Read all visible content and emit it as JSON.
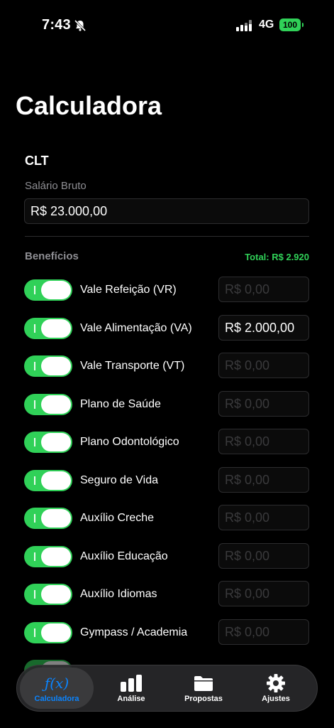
{
  "status": {
    "time": "7:43",
    "network": "4G",
    "battery": "100"
  },
  "title": "Calculadora",
  "salary": {
    "section": "CLT",
    "label": "Salário Bruto",
    "value": "R$ 23.000,00"
  },
  "benefits": {
    "title": "Benefícios",
    "total": "Total: R$ 2.920",
    "items": [
      {
        "label": "Vale Refeição (VR)",
        "value": "R$ 0,00",
        "on": true
      },
      {
        "label": "Vale Alimentação (VA)",
        "value": "R$ 2.000,00",
        "on": true
      },
      {
        "label": "Vale Transporte (VT)",
        "value": "R$ 0,00",
        "on": true
      },
      {
        "label": "Plano de Saúde",
        "value": "R$ 0,00",
        "on": true
      },
      {
        "label": "Plano Odontológico",
        "value": "R$ 0,00",
        "on": true
      },
      {
        "label": "Seguro de Vida",
        "value": "R$ 0,00",
        "on": true
      },
      {
        "label": "Auxílio Creche",
        "value": "R$ 0,00",
        "on": true
      },
      {
        "label": "Auxílio Educação",
        "value": "R$ 0,00",
        "on": true
      },
      {
        "label": "Auxílio Idiomas",
        "value": "R$ 0,00",
        "on": true
      },
      {
        "label": "Gympass / Academia",
        "value": "R$ 0,00",
        "on": true
      }
    ]
  },
  "tabs": [
    {
      "label": "Calculadora",
      "icon": "function-icon",
      "active": true
    },
    {
      "label": "Análise",
      "icon": "bar-chart-icon",
      "active": false
    },
    {
      "label": "Propostas",
      "icon": "folder-icon",
      "active": false
    },
    {
      "label": "Ajustes",
      "icon": "gear-icon",
      "active": false
    }
  ],
  "colors": {
    "accent": "#30d158",
    "tab_active": "#0a84ff",
    "background": "#000000"
  }
}
